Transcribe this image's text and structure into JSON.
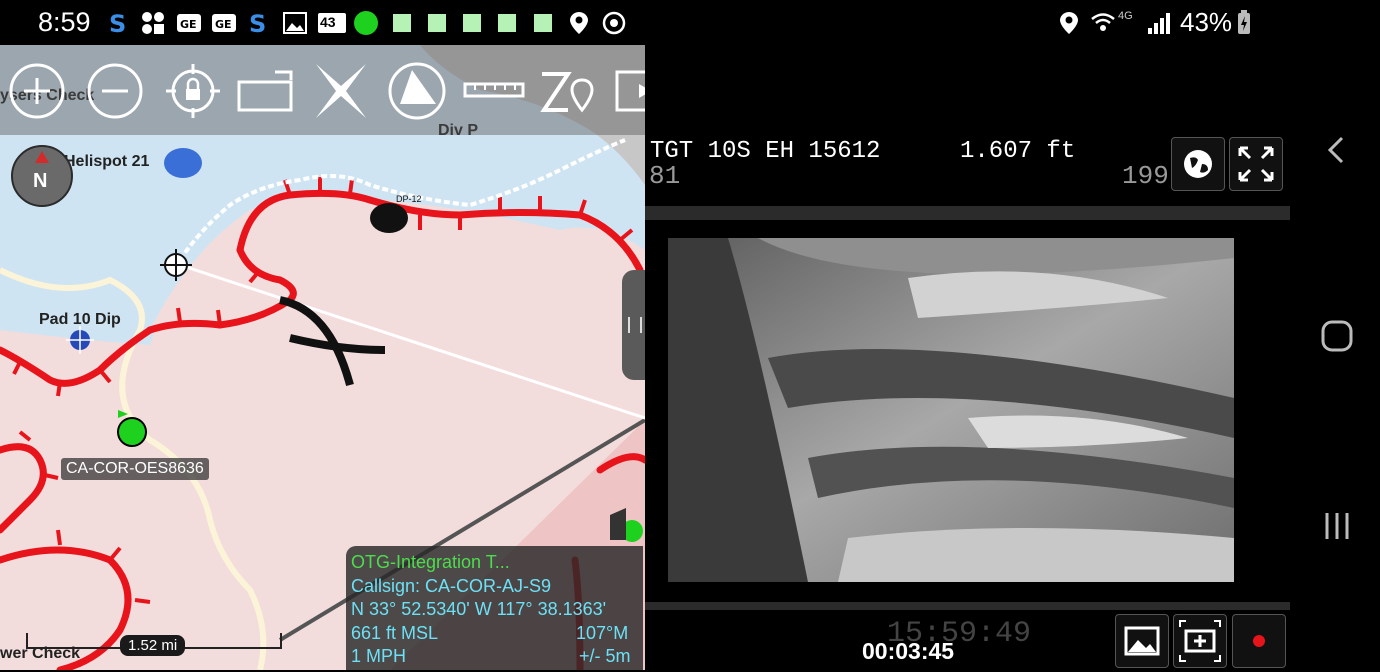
{
  "status_bar": {
    "time": "8:59",
    "battery": "43%",
    "network": "4G",
    "badge": "43"
  },
  "map": {
    "labels": {
      "sensors_check": "ysers Check",
      "div_p": "Div P",
      "helispot": "Helispot 21",
      "pad": "Pad 10 Dip",
      "dp": "DP-12",
      "lower_check": "wer Check"
    },
    "compass": "N",
    "unit_callsign": "CA-COR-OES8636",
    "scale": "1.52 mi",
    "toolbar_icons": [
      "zoom-in-icon",
      "zoom-out-icon",
      "lock-position-icon",
      "rotate-icon",
      "close-x-icon",
      "cone-icon",
      "ruler-icon",
      "elevation-icon",
      "video-icon",
      "contacts-icon",
      "add-point-icon",
      "add-globe-icon",
      "layers-icon",
      "map-icon",
      "edit-icon",
      "mission-icon",
      "menu-icon"
    ]
  },
  "info_box": {
    "title": "OTG-Integration T...",
    "callsign": "Callsign: CA-COR-AJ-S9",
    "coords": "N 33° 52.5340'  W 117° 38.1363'",
    "altitude": "661 ft MSL",
    "heading": "107°M",
    "speed": "1 MPH",
    "accuracy": "+/- 5m"
  },
  "video": {
    "tgt": "TGT 10S EH 15612",
    "range": "1.607 ft",
    "overlay_num_left": "81",
    "overlay_num_right": "199",
    "overlay_clock": "15:59:49",
    "timer": "00:03:45"
  },
  "colors": {
    "fire_line": "#e8141b",
    "map_pink": "#f3dcdc",
    "map_blue": "#cfe4f2",
    "info_text": "#6ce0f5",
    "info_title": "#4cdd4c",
    "unit_green": "#1fd11f"
  }
}
